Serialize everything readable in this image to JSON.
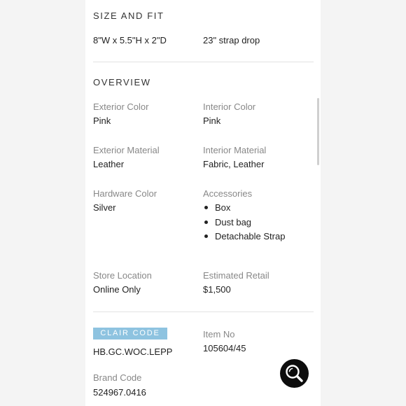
{
  "size_and_fit": {
    "title": "SIZE AND FIT",
    "dimensions": "8\"W x 5.5\"H x 2\"D",
    "strap_drop": "23\" strap drop"
  },
  "overview": {
    "title": "OVERVIEW",
    "exterior_color": {
      "label": "Exterior Color",
      "value": "Pink"
    },
    "interior_color": {
      "label": "Interior Color",
      "value": "Pink"
    },
    "exterior_material": {
      "label": "Exterior Material",
      "value": "Leather"
    },
    "interior_material": {
      "label": "Interior Material",
      "value": "Fabric, Leather"
    },
    "hardware_color": {
      "label": "Hardware Color",
      "value": "Silver"
    },
    "accessories": {
      "label": "Accessories",
      "items": [
        "Box",
        "Dust bag",
        "Detachable Strap"
      ]
    },
    "store_location": {
      "label": "Store Location",
      "value": "Online Only"
    },
    "estimated_retail": {
      "label": "Estimated Retail",
      "value": "$1,500"
    }
  },
  "codes": {
    "clair_code": {
      "label": "CLAIR CODE",
      "value": "HB.GC.WOC.LEPP"
    },
    "item_no": {
      "label": "Item No",
      "value": "105604/45"
    },
    "brand_code": {
      "label": "Brand Code",
      "value": "524967.0416"
    }
  },
  "search_button": {
    "icon": "search-icon"
  },
  "colors": {
    "badge_bg": "#8ec3e0",
    "fab_bg": "#0d0d0d",
    "label_gray": "#888888",
    "page_bg": "#f4f4f4"
  }
}
